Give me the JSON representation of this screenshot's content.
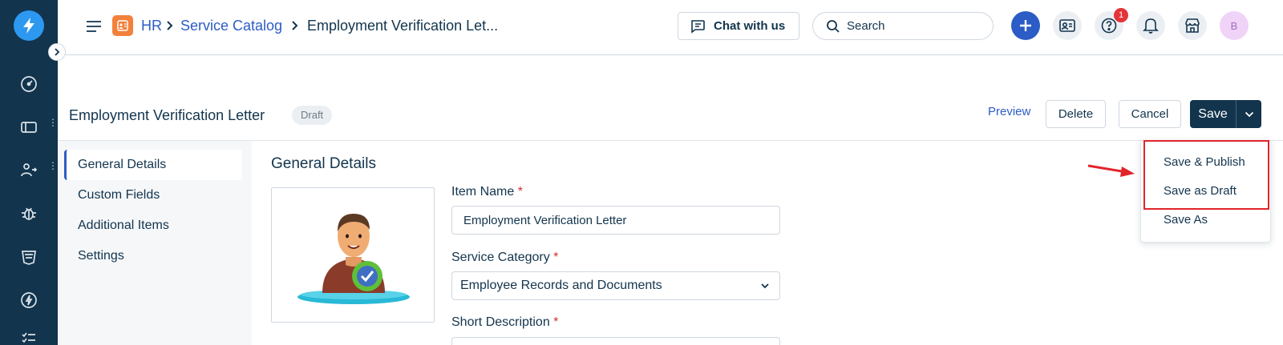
{
  "topbar": {
    "breadcrumbs": {
      "module": "HR",
      "catalog": "Service Catalog",
      "current": "Employment Verification Let..."
    },
    "chat_label": "Chat with us",
    "search_placeholder": "Search",
    "help_badge_count": "1",
    "avatar_initial": "B"
  },
  "page": {
    "title": "Employment Verification Letter",
    "status_badge": "Draft",
    "actions": {
      "preview": "Preview",
      "delete": "Delete",
      "cancel": "Cancel",
      "save": "Save"
    }
  },
  "save_menu": {
    "items": [
      "Save & Publish",
      "Save as Draft",
      "Save As"
    ]
  },
  "subnav": {
    "items": [
      "General Details",
      "Custom Fields",
      "Additional Items",
      "Settings"
    ],
    "active": "General Details"
  },
  "form": {
    "section_title": "General Details",
    "item_name": {
      "label": "Item Name",
      "required_mark": "*",
      "value": "Employment Verification Letter"
    },
    "service_category": {
      "label": "Service Category",
      "required_mark": "*",
      "value": "Employee Records and Documents"
    },
    "short_description": {
      "label": "Short Description",
      "required_mark": "*"
    }
  },
  "colors": {
    "rail": "#12344d",
    "accent": "#2c5cc5",
    "hr_badge": "#f3813b",
    "highlight": "#e0252b"
  }
}
